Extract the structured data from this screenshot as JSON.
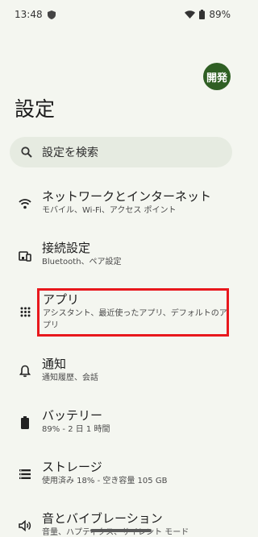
{
  "status_bar": {
    "time": "13:48",
    "battery": "89%"
  },
  "header": {
    "dev_badge": "開発",
    "title": "設定"
  },
  "search": {
    "placeholder": "設定を検索"
  },
  "items": [
    {
      "title": "ネットワークとインターネット",
      "subtitle": "モバイル、Wi-Fi、アクセス ポイント",
      "icon": "wifi-icon"
    },
    {
      "title": "接続設定",
      "subtitle": "Bluetooth、ペア設定",
      "icon": "connected-devices-icon"
    },
    {
      "title": "アプリ",
      "subtitle": "アシスタント、最近使ったアプリ、デフォルトのアプリ",
      "icon": "apps-grid-icon"
    },
    {
      "title": "通知",
      "subtitle": "通知履歴、会話",
      "icon": "bell-icon"
    },
    {
      "title": "バッテリー",
      "subtitle": "89% - 2 日 1 時間",
      "icon": "battery-icon"
    },
    {
      "title": "ストレージ",
      "subtitle": "使用済み 18% - 空き容量 105 GB",
      "icon": "storage-icon"
    },
    {
      "title": "音とバイブレーション",
      "subtitle": "音量、ハプティクス、サイレント モード",
      "icon": "sound-icon"
    }
  ],
  "colors": {
    "background": "#f4f6f0",
    "search_background": "#e6ebe1",
    "dev_badge": "#2f5f24",
    "highlight": "#e8181d"
  }
}
